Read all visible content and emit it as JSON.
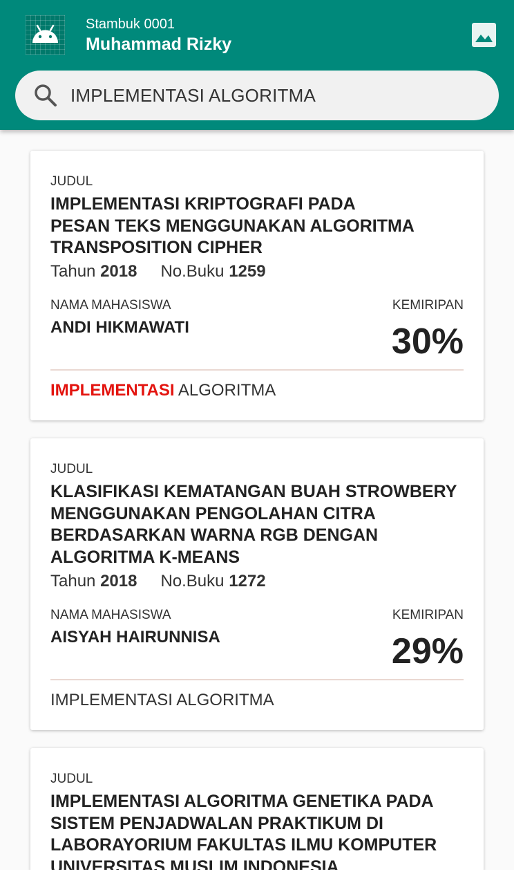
{
  "header": {
    "stambuk": "Stambuk 0001",
    "name": "Muhammad Rizky",
    "avatar_icon": "android-icon",
    "image_button_icon": "image-icon",
    "colors": {
      "appbar": "#00897b",
      "highlight": "#e3140f"
    }
  },
  "search": {
    "icon": "search-icon",
    "value": "IMPLEMENTASI ALGORITMA"
  },
  "labels": {
    "judul": "JUDUL",
    "tahun": "Tahun",
    "no_buku": "No.Buku",
    "nama_mahasiswa": "NAMA MAHASISWA",
    "kemiripan": "KEMIRIPAN"
  },
  "results": [
    {
      "title_lines": [
        "IMPLEMENTASI KRIPTOGRAFI PADA",
        "PESAN TEKS MENGGUNAKAN ALGORITMA",
        "TRANSPOSITION CIPHER"
      ],
      "tahun": "2018",
      "no_buku": "1259",
      "mahasiswa": "ANDI HIKMAWATI",
      "kemiripan": "30%",
      "keyword_highlight": "IMPLEMENTASI",
      "keyword_rest": " ALGORITMA"
    },
    {
      "title_lines": [
        "KLASIFIKASI KEMATANGAN BUAH STROWBERY",
        "MENGGUNAKAN PENGOLAHAN CITRA",
        "BERDASARKAN WARNA RGB DENGAN",
        "ALGORITMA K-MEANS"
      ],
      "tahun": "2018",
      "no_buku": "1272",
      "mahasiswa": "AISYAH HAIRUNNISA",
      "kemiripan": "29%",
      "keyword_highlight": "",
      "keyword_rest": "IMPLEMENTASI ALGORITMA"
    },
    {
      "title_lines": [
        "IMPLEMENTASI ALGORITMA GENETIKA PADA",
        "SISTEM PENJADWALAN PRAKTIKUM DI",
        "LABORAYORIUM FAKULTAS ILMU KOMPUTER",
        "UNIVERSITAS MUSLIM INDONESIA"
      ]
    }
  ]
}
